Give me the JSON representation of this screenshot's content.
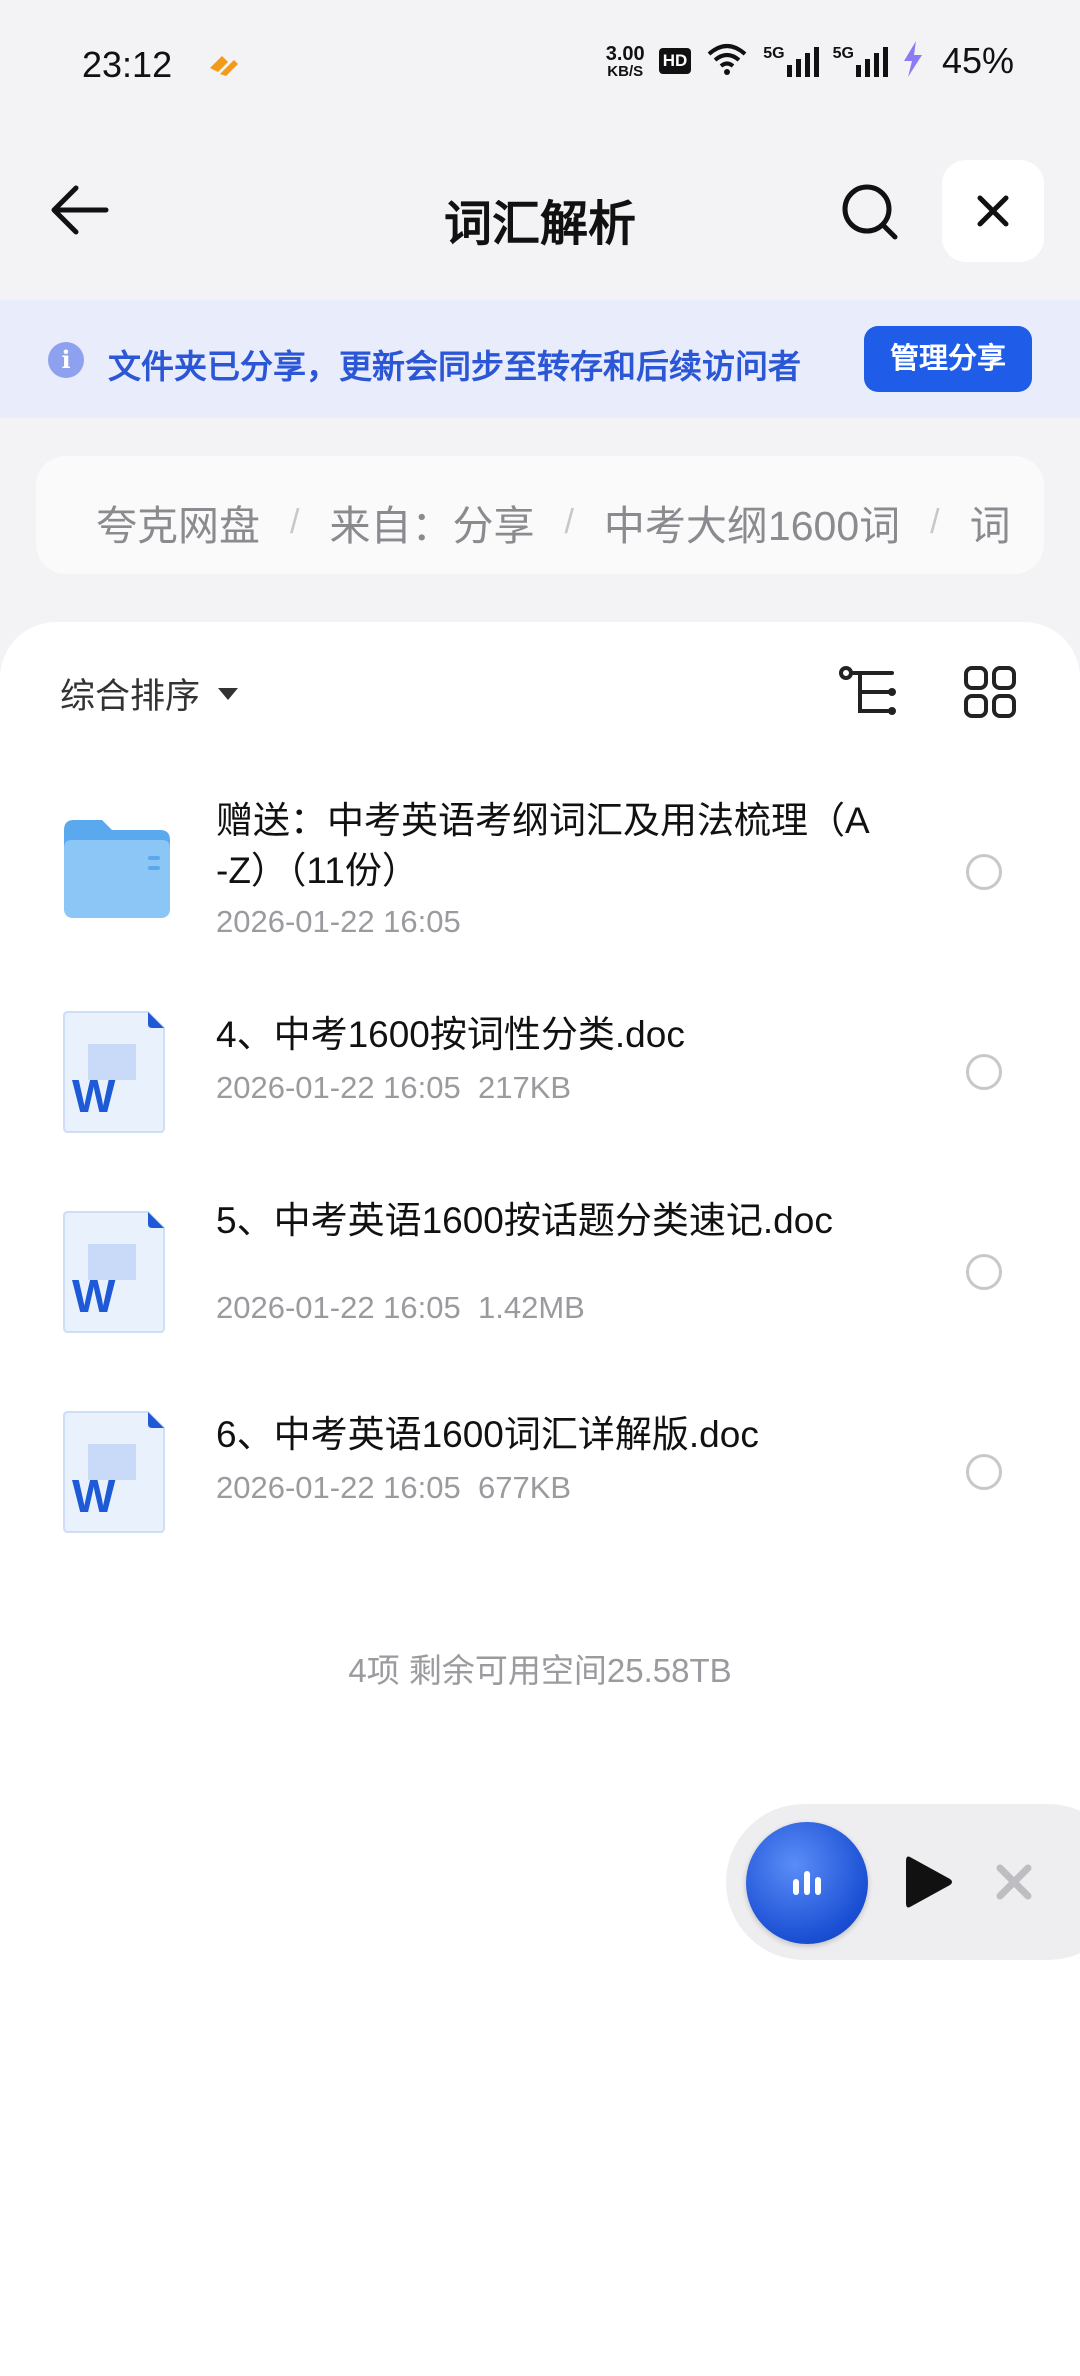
{
  "status_bar": {
    "time": "23:12",
    "net_speed_value": "3.00",
    "net_speed_unit": "KB/S",
    "hd_label": "HD",
    "network_1": "5G",
    "network_2": "5G",
    "battery": "45%",
    "icons": [
      "app-notification-icon",
      "wifi-icon",
      "signal-icon",
      "charging-icon"
    ]
  },
  "title_bar": {
    "title": "词汇解析",
    "icons": [
      "back-arrow-icon",
      "search-icon",
      "close-icon"
    ]
  },
  "share_banner": {
    "text": "文件夹已分享，更新会同步至转存和后续访问者",
    "button": "管理分享",
    "accent": "#1f5ce8"
  },
  "breadcrumb": {
    "items": [
      "夸克网盘",
      "来自：分享",
      "中考大纲1600词",
      "词"
    ],
    "separator": "/"
  },
  "toolbar": {
    "sort_label": "综合排序",
    "icons": [
      "tree-view-icon",
      "grid-view-icon"
    ]
  },
  "files": [
    {
      "type": "folder",
      "name": "赠送：中考英语考纲词汇及用法梳理（A-Z）（11份）",
      "meta": "2026-01-22 16:05"
    },
    {
      "type": "word",
      "name": "4、中考1600按词性分类.doc",
      "meta": "2026-01-22 16:05  217KB"
    },
    {
      "type": "word",
      "name": "5、中考英语1600按话题分类速记.doc",
      "meta": "2026-01-22 16:05  1.42MB"
    },
    {
      "type": "word",
      "name": "6、中考英语1600词汇详解版.doc",
      "meta": "2026-01-22 16:05  677KB"
    }
  ],
  "footer": "4项 剩余可用空间25.58TB",
  "player": {
    "icons": [
      "audio-bars-icon",
      "play-icon",
      "close-icon"
    ]
  }
}
